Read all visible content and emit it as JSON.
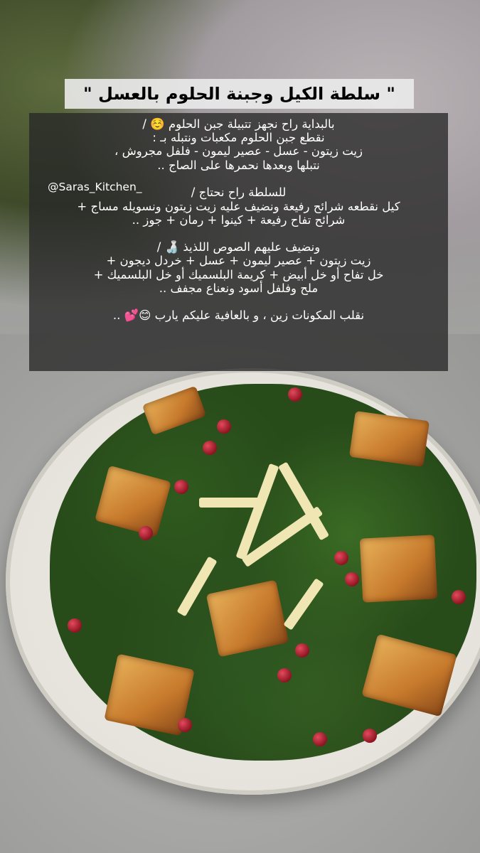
{
  "title": "\" سلطة الكيل وجبنة الحلوم بالعسل \"",
  "handle": "@Saras_Kitchen_",
  "lines_part1": [
    "بالبداية راح نجهز تتبيلة جبن الحلوم ☺️ /",
    "نقطع جبن الحلوم مكعبات ونتبله بـ :",
    "زيت زيتون - عسل - عصير ليمون - فلفل مجروش ،",
    "نتبلها وبعدها نحمرها على الصاج .."
  ],
  "salad_heading": "للسلطة راح نحتاج /",
  "lines_part2": [
    "كيل نقطعه شرائح رفيعة ونضيف عليه زيت زيتون ونسويله مساج +",
    "شرائح تفاح رفيعة + كينوا + رمان + جوز .."
  ],
  "lines_part3": [
    "ونضيف عليهم الصوص اللذيذ 🍶 /",
    "زيت زيتون + عصير ليمون + عسل + خردل ديجون +",
    "خل تفاح أو خل أبيض + كريمة البلسميك أو خل البلسميك +",
    "ملح وفلفل أسود ونعناع مجفف .."
  ],
  "closing": "نقلب المكونات زين ، و بالعافية عليكم يارب 😊💕 .."
}
